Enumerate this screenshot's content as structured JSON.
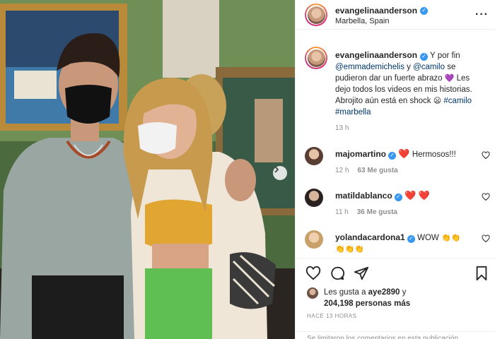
{
  "header": {
    "username": "evangelinaanderson",
    "location": "Marbella, Spain",
    "more_label": "···"
  },
  "caption": {
    "username": "evangelinaanderson",
    "text_part1": " Y por fin ",
    "mention1": "@emmademichelis",
    "text_part2": " y ",
    "mention2": "@camilo",
    "text_part3": " se pudieron dar un fuerte abrazo ",
    "emoji1": "💜",
    "text_part4": " Les dejo todos los videos en mis historias. Abrojito aún está en shock ",
    "emoji2": "😦",
    "tag1": "#camilo",
    "tag2": "#marbella",
    "time": "13 h"
  },
  "comments": [
    {
      "username": "majomartino",
      "verified": true,
      "text": "Hermosos!!!",
      "emoji": "❤️",
      "time": "12 h",
      "likes": "63 Me gusta"
    },
    {
      "username": "matildablanco",
      "verified": true,
      "text": "",
      "emoji": "❤️ ❤️",
      "time": "11 h",
      "likes": "36 Me gusta"
    },
    {
      "username": "yolandacardona1",
      "verified": true,
      "text": "WOW",
      "emoji": "👏👏",
      "emoji_line2": "👏👏👏"
    }
  ],
  "likes": {
    "prefix": "Les gusta a ",
    "user": "aye2890",
    "middle": " y",
    "count": "204,198 personas más"
  },
  "posted": "HACE 13 HORAS",
  "footer": "Se limitaron los comentarios en esta publicación",
  "colors": {
    "link": "#00376b",
    "meta": "#8e8e8e",
    "verified": "#3897f0"
  }
}
